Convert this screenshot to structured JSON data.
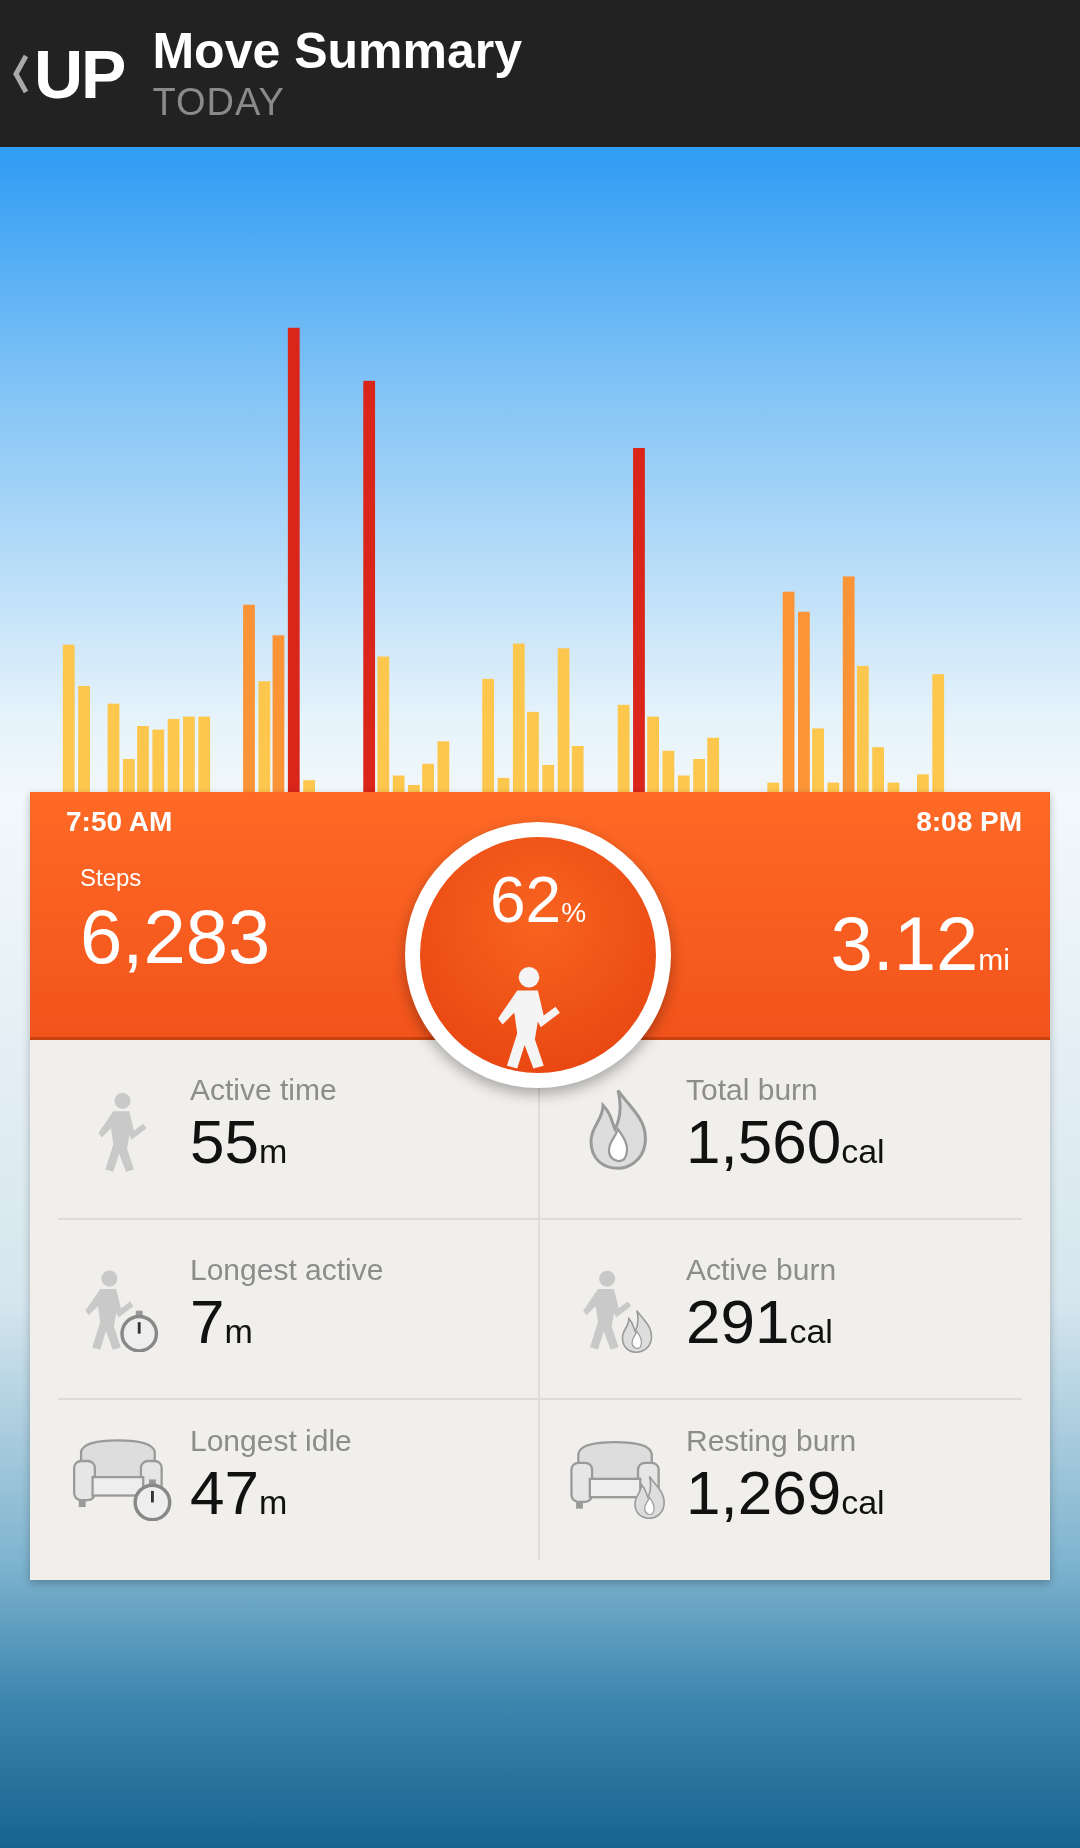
{
  "header": {
    "logo": "UP",
    "title": "Move Summary",
    "subtitle": "TODAY"
  },
  "timeline": {
    "start": "7:50 AM",
    "end": "8:08 PM"
  },
  "steps": {
    "label": "Steps",
    "value": "6,283"
  },
  "goal": {
    "value": "62",
    "unit": "%"
  },
  "distance": {
    "value": "3.12",
    "unit": "mi"
  },
  "stats": [
    {
      "kind": "active-time",
      "label": "Active time",
      "value": "55",
      "unit": "m"
    },
    {
      "kind": "total-burn",
      "label": "Total burn",
      "value": "1,560",
      "unit": "cal"
    },
    {
      "kind": "longest-active",
      "label": "Longest active",
      "value": "7",
      "unit": "m"
    },
    {
      "kind": "active-burn",
      "label": "Active burn",
      "value": "291",
      "unit": "cal"
    },
    {
      "kind": "longest-idle",
      "label": "Longest idle",
      "value": "47",
      "unit": "m"
    },
    {
      "kind": "resting-burn",
      "label": "Resting burn",
      "value": "1,269",
      "unit": "cal"
    }
  ]
}
